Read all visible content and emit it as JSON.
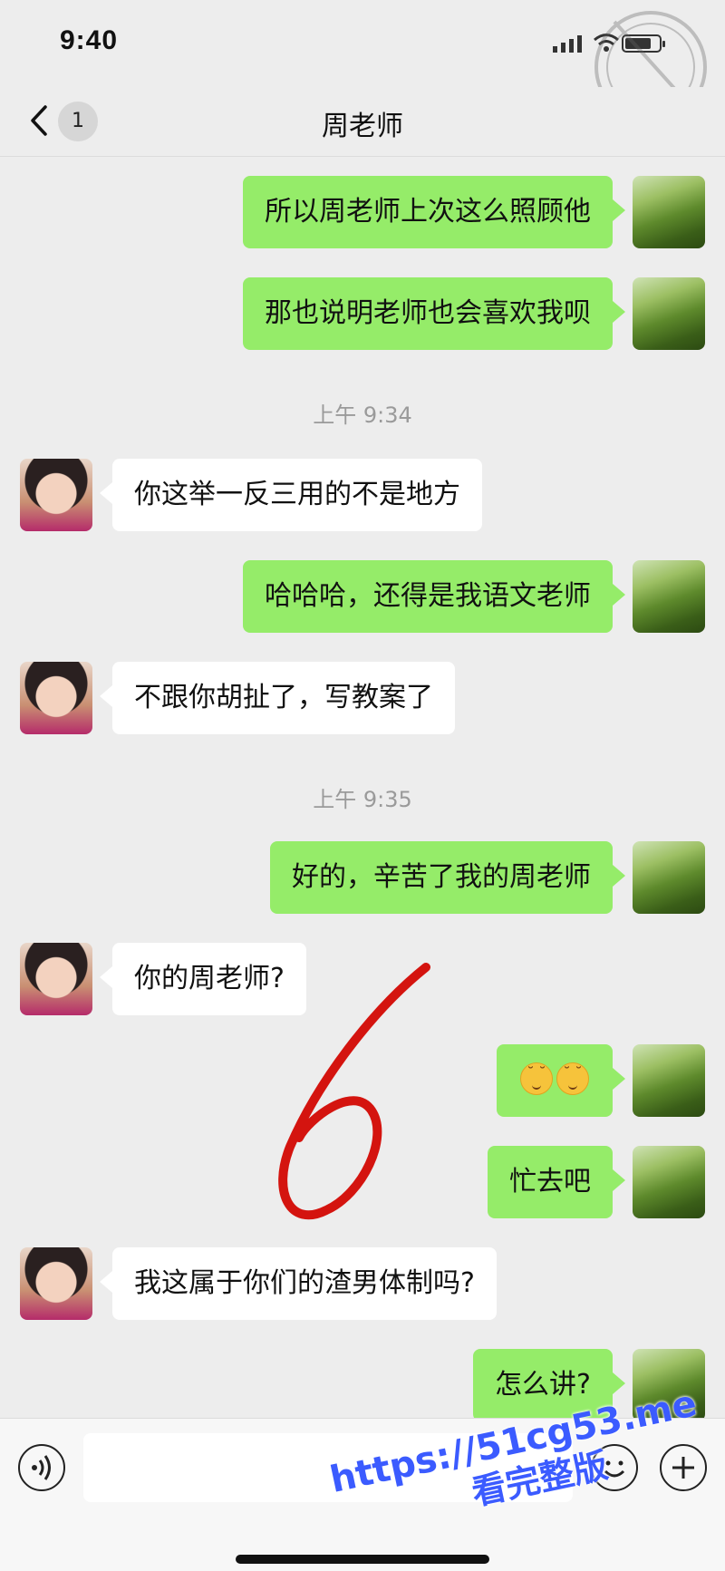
{
  "status_bar": {
    "time": "9:40"
  },
  "nav": {
    "unread_count": "1",
    "title": "周老师"
  },
  "messages": [
    {
      "side": "out",
      "text": "所以周老师上次这么照顾他"
    },
    {
      "side": "out",
      "text": "那也说明老师也会喜欢我呗"
    },
    {
      "side": "time",
      "text": "上午 9:34"
    },
    {
      "side": "in",
      "text": "你这举一反三用的不是地方"
    },
    {
      "side": "out",
      "text": "哈哈哈，还得是我语文老师"
    },
    {
      "side": "in",
      "text": "不跟你胡扯了，写教案了"
    },
    {
      "side": "time",
      "text": "上午 9:35"
    },
    {
      "side": "out",
      "text": "好的，辛苦了我的周老师"
    },
    {
      "side": "in",
      "text": "你的周老师?"
    },
    {
      "side": "out",
      "emojis": [
        "relieved-face-emoji",
        "relieved-face-emoji"
      ]
    },
    {
      "side": "out",
      "text": "忙去吧"
    },
    {
      "side": "in",
      "text": "我这属于你们的渣男体制吗?"
    },
    {
      "side": "out",
      "text": "怎么讲?"
    }
  ],
  "input_bar": {
    "placeholder": ""
  },
  "watermark": {
    "url": "https://51cg53.me",
    "subtitle": "看完整版"
  },
  "colors": {
    "outgoing_bubble": "#95ec69",
    "incoming_bubble": "#ffffff",
    "background": "#ededed",
    "annotation": "#d4140f",
    "watermark": "#3b5bff"
  }
}
